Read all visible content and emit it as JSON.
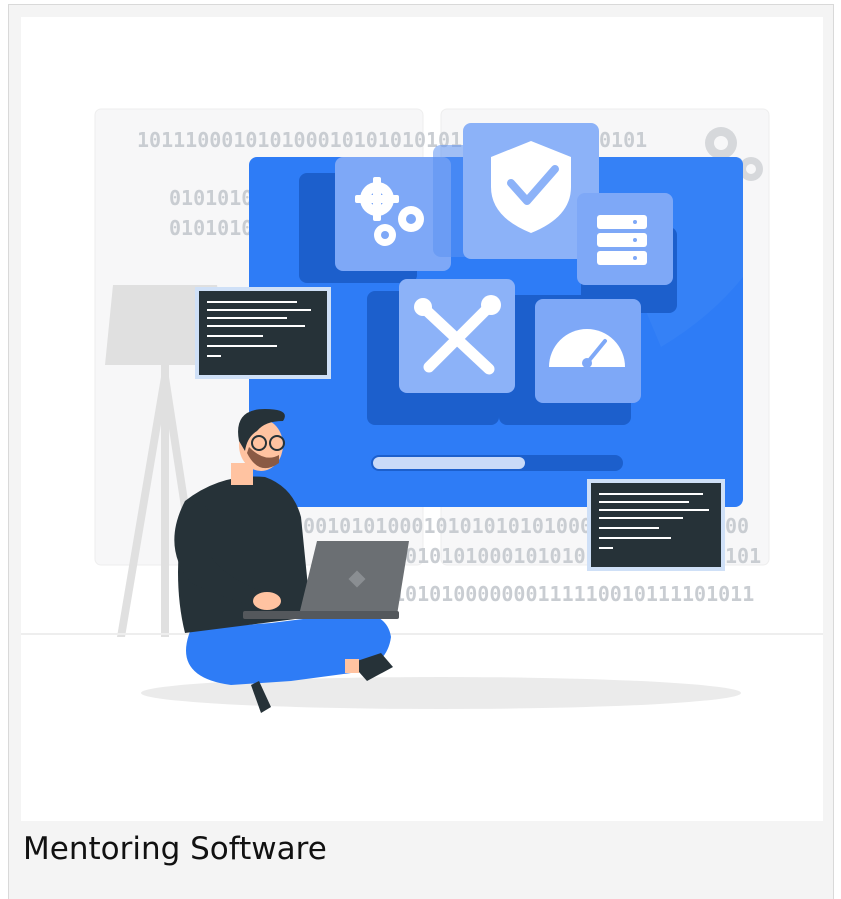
{
  "card": {
    "caption": "Mentoring Software",
    "illustration": {
      "binary_lines": [
        "101110001010100010101010101010101000",
        "0101010000",
        "0101010000",
        "0101",
        "000101010001010101010100011111010",
        "10101010001010101000001",
        "00",
        "101",
        "101010000000111110010111101011"
      ],
      "icons": [
        "gears-icon",
        "shield-check-icon",
        "server-icon",
        "tools-icon",
        "speedometer-icon",
        "terminal-icon",
        "laptop-icon",
        "person-illustration",
        "floor-lamp",
        "cog-icon"
      ]
    },
    "colors": {
      "primary_blue": "#2e7cf6",
      "tile_blue": "#7ea8f7",
      "dark_panel": "#263238",
      "skin": "#ffc3a1"
    }
  }
}
